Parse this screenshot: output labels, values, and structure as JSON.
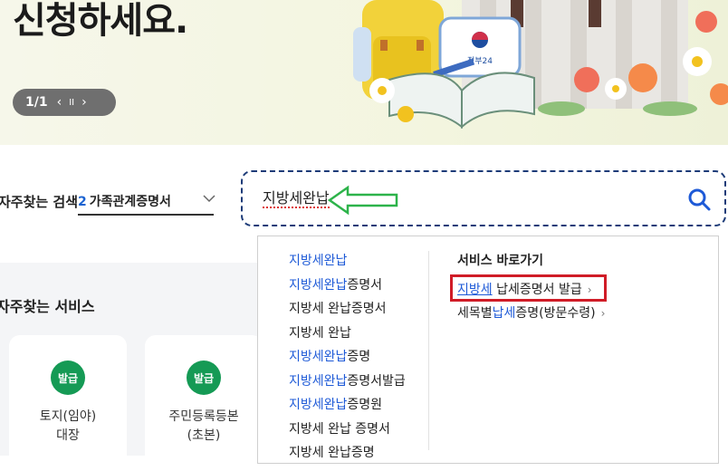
{
  "banner": {
    "title": "신청하세요.",
    "pager": {
      "count": "1/1",
      "prev": "‹",
      "pause": "II",
      "next": "›"
    },
    "illustration_badge": "정부24"
  },
  "search": {
    "frequent_label": "자주찾는 검색",
    "rank_number": "2",
    "rank_text": "가족관계증명서",
    "query": "지방세완납"
  },
  "suggestions": [
    {
      "hl": "지방세완납",
      "rest": ""
    },
    {
      "hl": "지방세완납",
      "rest": "증명서"
    },
    {
      "hl": "",
      "rest": "지방세 완납증명서"
    },
    {
      "hl": "",
      "rest": "지방세 완납"
    },
    {
      "hl": "지방세완납",
      "rest": "증명"
    },
    {
      "hl": "지방세완납",
      "rest": "증명서발급"
    },
    {
      "hl": "지방세완납",
      "rest": "증명원"
    },
    {
      "hl": "",
      "rest": "지방세 완납 증명서"
    },
    {
      "hl": "",
      "rest": "지방세 완납증명"
    }
  ],
  "service_shortcuts": {
    "title": "서비스 바로가기",
    "links": [
      {
        "pre": "",
        "hl": "지방세",
        "post": " 납세증명서 발급"
      },
      {
        "pre": "세목별",
        "hl": "납세",
        "post": "증명(방문수령)"
      }
    ]
  },
  "frequent_services": {
    "title": "자주찾는 서비스",
    "cards": [
      {
        "badge": "발급",
        "line1": "토지(임야)",
        "line2": "대장"
      },
      {
        "badge": "발급",
        "line1": "주민등록등본",
        "line2": "(초본)"
      }
    ]
  },
  "colors": {
    "accent_blue": "#1e5ad7",
    "badge_green": "#159a55",
    "highlight_red": "#d01c27",
    "annotation_green": "#2db34a"
  }
}
